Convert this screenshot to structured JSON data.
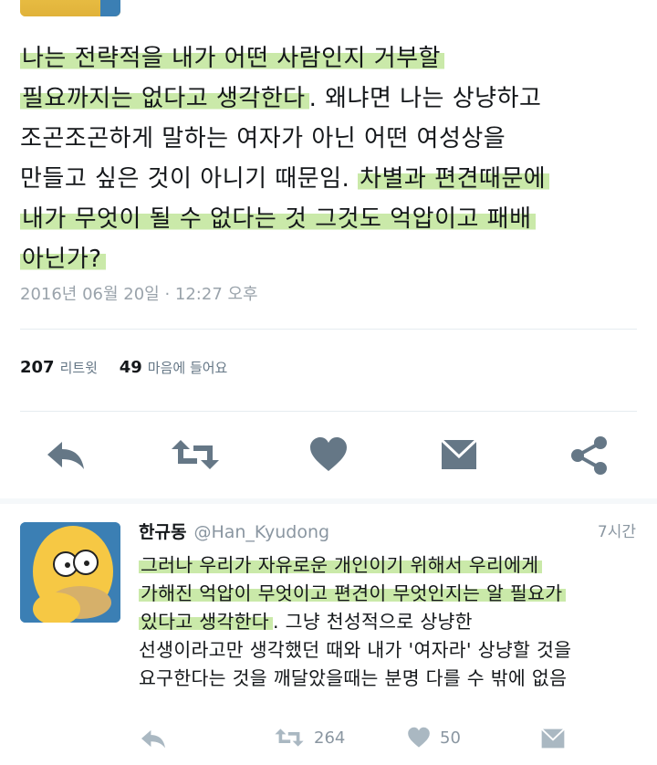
{
  "tweet": {
    "lines": [
      [
        {
          "text": "나는 전략적을 내가 어떤 사람인지 거부할",
          "hl": true
        }
      ],
      [
        {
          "text": "필요까지는 없다고 생각한다",
          "hl": true
        },
        {
          "text": ". 왜냐면 나는 상냥하고",
          "hl": false
        }
      ],
      [
        {
          "text": "조곤조곤하게 말하는 여자가 아닌 어떤 여성상을",
          "hl": false
        }
      ],
      [
        {
          "text": "만들고 싶은 것이 아니기 때문임. ",
          "hl": false
        },
        {
          "text": "차별과 편견때문에",
          "hl": true
        }
      ],
      [
        {
          "text": "내가 무엇이 될 수 없다는 것 그것도 억압이고 패배",
          "hl": true
        }
      ],
      [
        {
          "text": "아닌가?",
          "hl": true
        }
      ]
    ],
    "timestamp": "2016년 06월 20일 · 12:27 오후",
    "retweet_count": "207",
    "retweet_label": "리트윗",
    "like_count": "49",
    "like_label": "마음에 들어요",
    "action_icons": [
      "reply-icon",
      "retweet-icon",
      "heart-icon",
      "envelope-icon",
      "share-icon"
    ],
    "icon_color": "#657786"
  },
  "reply": {
    "name": "한규동",
    "handle": "@Han_Kyudong",
    "time": "7시간",
    "lines": [
      [
        {
          "text": "그러나 우리가 자유로운 개인이기 위해서 우리에게",
          "hl": true
        }
      ],
      [
        {
          "text": "가해진 억압이 무엇이고 편견이 무엇인지는 알 필요가",
          "hl": true
        }
      ],
      [
        {
          "text": "있다고 생각한다",
          "hl": true
        },
        {
          "text": ". 그냥 천성적으로 상냥한",
          "hl": false
        }
      ],
      [
        {
          "text": "선생이라고만 생각했던 때와 내가 '여자라' 상냥할 것을",
          "hl": false
        }
      ],
      [
        {
          "text": "요구한다는 것을 깨달았을때는 분명 다를 수 밖에 없음",
          "hl": false
        }
      ]
    ],
    "retweet_count": "264",
    "like_count": "50",
    "icon_color": "#aab8c2"
  },
  "colors": {
    "highlight": "#b8e28c",
    "text": "#14171a",
    "muted": "#9aa3ab"
  }
}
